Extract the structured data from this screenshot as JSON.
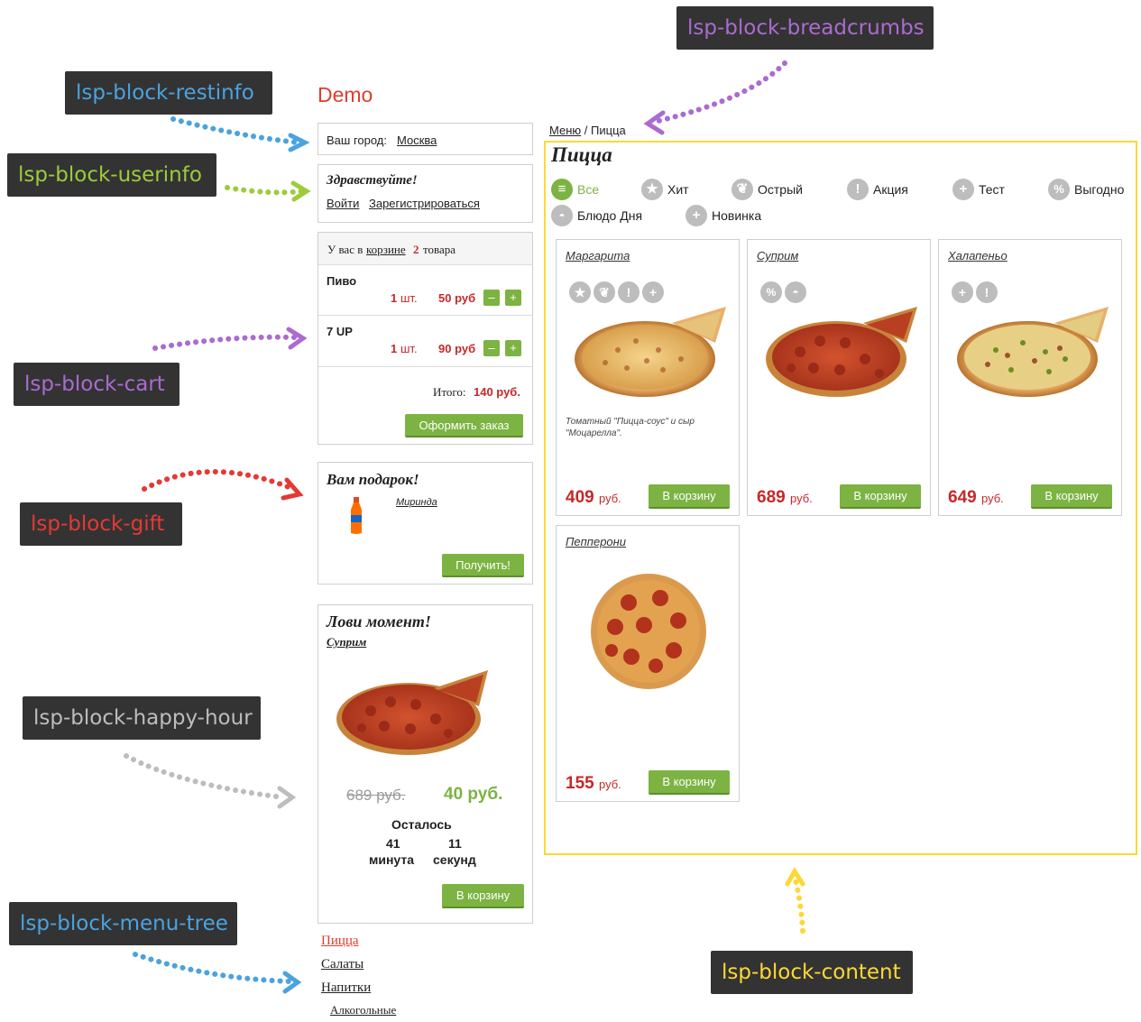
{
  "site_title": "Demo",
  "callouts": {
    "restinfo": "lsp-block-restinfo",
    "userinfo": "lsp-block-userinfo",
    "cart": "lsp-block-cart",
    "gift": "lsp-block-gift",
    "happy_hour": "lsp-block-happy-hour",
    "menu_tree": "lsp-block-menu-tree",
    "breadcrumbs": "lsp-block-breadcrumbs",
    "content": "lsp-block-content"
  },
  "colors": {
    "restinfo": "#4aa3df",
    "userinfo": "#9ccc3c",
    "cart": "#ab6bd0",
    "gift": "#e53935",
    "happy_hour": "#bdbdbd",
    "menu_tree": "#4aa3df",
    "breadcrumbs": "#ab6bd0",
    "content": "#fdd835",
    "accent_green": "#7cb342",
    "price_red": "#c62828"
  },
  "restinfo": {
    "city_label": "Ваш город:",
    "city_value": "Москва"
  },
  "userinfo": {
    "greeting": "Здравствуйте!",
    "login": "Войти",
    "register": "Зарегистрироваться"
  },
  "cart": {
    "summary_prefix": "У вас в",
    "summary_link": "корзине",
    "count": "2",
    "summary_suffix": "товара",
    "items": [
      {
        "name": "Пиво",
        "qty": "1",
        "qty_unit": "шт.",
        "price": "50 руб",
        "minus": "–",
        "plus": "+"
      },
      {
        "name": "7 UP",
        "qty": "1",
        "qty_unit": "шт.",
        "price": "90 руб",
        "minus": "–",
        "plus": "+"
      }
    ],
    "total_label": "Итого:",
    "total_value": "140 руб.",
    "checkout": "Оформить заказ"
  },
  "gift": {
    "title": "Вам подарок!",
    "item": "Миринда",
    "button": "Получить!"
  },
  "happy_hour": {
    "title": "Лови момент!",
    "item": "Суприм",
    "old_price": "689 руб.",
    "new_price": "40 руб.",
    "remaining_label": "Осталось",
    "minutes_value": "41",
    "minutes_label": "минута",
    "seconds_value": "11",
    "seconds_label": "секунд",
    "button": "В корзину"
  },
  "menu_tree": {
    "items": [
      "Пицца",
      "Салаты",
      "Напитки"
    ],
    "sub_items": [
      "Алкогольные"
    ]
  },
  "breadcrumbs": {
    "root": "Меню",
    "separator": "/",
    "current": "Пицца"
  },
  "content": {
    "heading": "Пицца",
    "categories": [
      {
        "label": "Все",
        "icon": "list-icon"
      },
      {
        "label": "Хит",
        "icon": "star-icon"
      },
      {
        "label": "Острый",
        "icon": "leaf-icon"
      },
      {
        "label": "Акция",
        "icon": "exclamation-icon"
      },
      {
        "label": "Тест",
        "icon": "plus-icon"
      },
      {
        "label": "Выгодно",
        "icon": "percent-icon"
      },
      {
        "label": "Блюдо Дня",
        "icon": "dish-icon"
      },
      {
        "label": "Новинка",
        "icon": "plus-icon"
      }
    ],
    "products": [
      {
        "name": "Маргарита",
        "description": "Томатный \"Пицца-соус\" и сыр \"Моцарелла\".",
        "price": "409",
        "currency": "руб.",
        "button": "В корзину"
      },
      {
        "name": "Суприм",
        "description": "",
        "price": "689",
        "currency": "руб.",
        "button": "В корзину"
      },
      {
        "name": "Халапеньо",
        "description": "",
        "price": "649",
        "currency": "руб.",
        "button": "В корзину"
      },
      {
        "name": "Пепперони",
        "description": "",
        "price": "155",
        "currency": "руб.",
        "button": "В корзину"
      }
    ]
  }
}
